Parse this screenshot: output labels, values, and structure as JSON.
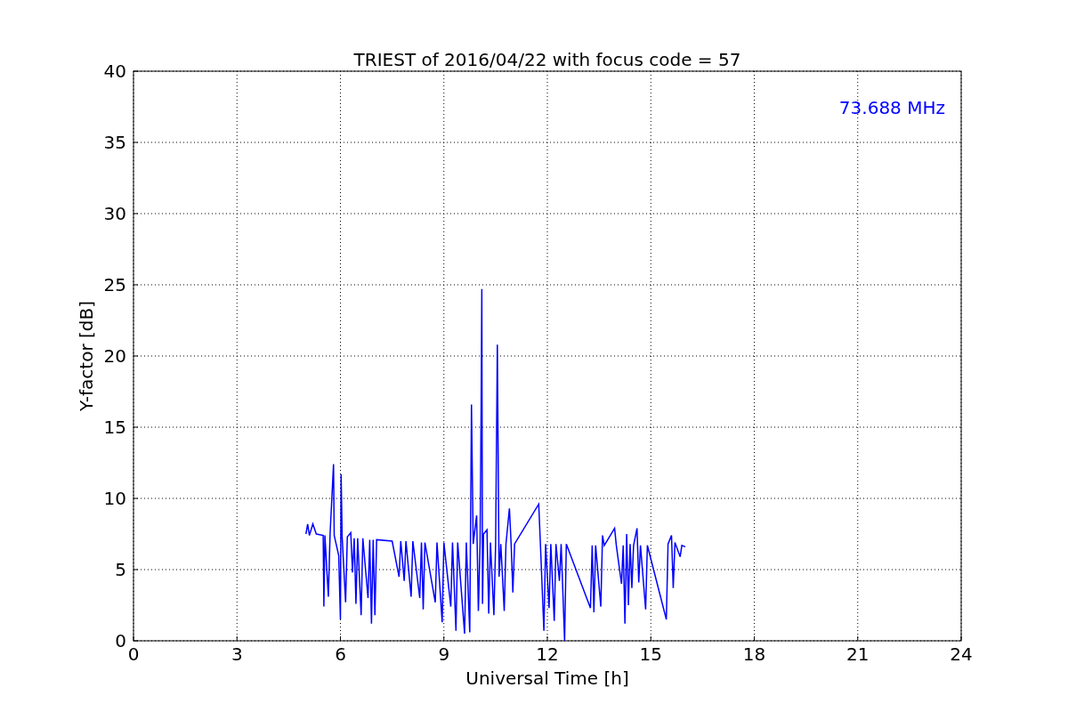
{
  "chart_data": {
    "type": "line",
    "title": "TRIEST of 2016/04/22 with focus code = 57",
    "xlabel": "Universal Time [h]",
    "ylabel": "Y-factor [dB]",
    "xlim": [
      0,
      24
    ],
    "ylim": [
      0,
      40
    ],
    "xticks": [
      0,
      3,
      6,
      9,
      12,
      15,
      18,
      21,
      24
    ],
    "yticks": [
      0,
      5,
      10,
      15,
      20,
      25,
      30,
      35,
      40
    ],
    "x": [
      5.0,
      5.05,
      5.1,
      5.2,
      5.3,
      5.5,
      5.52,
      5.55,
      5.65,
      5.7,
      5.8,
      5.82,
      5.95,
      6.0,
      6.02,
      6.05,
      6.15,
      6.2,
      6.3,
      6.35,
      6.4,
      6.45,
      6.5,
      6.6,
      6.65,
      6.8,
      6.85,
      6.9,
      6.95,
      7.0,
      7.05,
      7.5,
      7.7,
      7.75,
      7.85,
      7.9,
      8.05,
      8.1,
      8.3,
      8.35,
      8.4,
      8.45,
      8.75,
      8.8,
      8.95,
      9.0,
      9.2,
      9.25,
      9.35,
      9.4,
      9.6,
      9.65,
      9.75,
      9.8,
      9.85,
      9.95,
      10.0,
      10.05,
      10.08,
      10.1,
      10.12,
      10.15,
      10.25,
      10.3,
      10.35,
      10.45,
      10.5,
      10.55,
      10.6,
      10.65,
      10.75,
      10.8,
      10.9,
      10.95,
      11.0,
      11.05,
      11.75,
      11.8,
      11.9,
      11.95,
      12.05,
      12.1,
      12.2,
      12.25,
      12.35,
      12.4,
      12.5,
      12.55,
      13.25,
      13.3,
      13.35,
      13.4,
      13.55,
      13.6,
      13.65,
      13.95,
      14.0,
      14.15,
      14.2,
      14.25,
      14.3,
      14.35,
      14.4,
      14.45,
      14.5,
      14.6,
      14.65,
      14.7,
      14.85,
      14.9,
      15.45,
      15.5,
      15.6,
      15.65,
      15.7,
      15.85,
      15.9,
      16.0
    ],
    "series": [
      {
        "name": "73.688 MHz",
        "color": "#0000ff",
        "values": [
          7.5,
          8.2,
          7.4,
          8.2,
          7.5,
          7.4,
          2.4,
          7.4,
          3.1,
          7.5,
          12.4,
          7.4,
          6.0,
          1.5,
          11.7,
          7.3,
          2.7,
          7.3,
          7.6,
          4.8,
          7.2,
          2.6,
          7.2,
          1.8,
          7.2,
          3.0,
          7.1,
          1.2,
          7.1,
          1.8,
          7.1,
          7.0,
          4.5,
          7.0,
          4.2,
          7.0,
          3.1,
          7.0,
          3.0,
          6.9,
          2.2,
          6.9,
          2.7,
          6.9,
          1.3,
          6.9,
          2.4,
          6.9,
          0.7,
          6.9,
          0.5,
          6.9,
          0.6,
          16.6,
          6.8,
          8.8,
          2.1,
          6.9,
          16.4,
          24.7,
          2.6,
          7.5,
          7.8,
          1.9,
          6.9,
          1.8,
          6.8,
          20.8,
          4.5,
          6.8,
          2.1,
          6.8,
          9.3,
          6.8,
          3.4,
          6.8,
          9.6,
          6.7,
          0.7,
          6.8,
          2.3,
          6.8,
          1.4,
          6.8,
          4.2,
          6.8,
          0.0,
          6.8,
          2.3,
          6.7,
          2.0,
          6.7,
          2.4,
          7.4,
          6.7,
          7.9,
          6.7,
          4.0,
          6.7,
          1.2,
          7.5,
          2.5,
          6.8,
          3.7,
          6.7,
          7.9,
          4.1,
          6.7,
          2.2,
          6.7,
          1.5,
          6.8,
          7.4,
          3.7,
          6.9,
          5.9,
          6.7,
          6.6
        ]
      }
    ],
    "grid": true
  }
}
